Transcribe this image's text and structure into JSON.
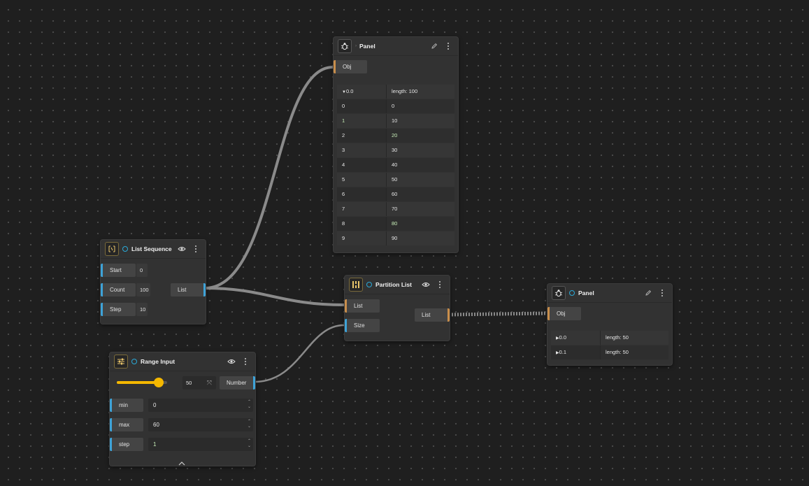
{
  "nodes": {
    "panel_top": {
      "title": "Panel",
      "input_port": "Obj",
      "root_key": "0.0",
      "root_value": "length: 100",
      "rows": [
        {
          "index": "0",
          "value": "0"
        },
        {
          "index": "1",
          "value": "10"
        },
        {
          "index": "2",
          "value": "20"
        },
        {
          "index": "3",
          "value": "30"
        },
        {
          "index": "4",
          "value": "40"
        },
        {
          "index": "5",
          "value": "50"
        },
        {
          "index": "6",
          "value": "60"
        },
        {
          "index": "7",
          "value": "70"
        },
        {
          "index": "8",
          "value": "80"
        },
        {
          "index": "9",
          "value": "90"
        }
      ]
    },
    "list_sequence": {
      "title": "List Sequence",
      "inputs": [
        {
          "label": "Start",
          "value": "0"
        },
        {
          "label": "Count",
          "value": "100"
        },
        {
          "label": "Step",
          "value": "10"
        }
      ],
      "output_port": "List"
    },
    "partition_list": {
      "title": "Partition List",
      "inputs": [
        {
          "label": "List"
        },
        {
          "label": "Size"
        }
      ],
      "output_port": "List"
    },
    "panel_right": {
      "title": "Panel",
      "input_port": "Obj",
      "rows": [
        {
          "key": "0.0",
          "value": "length: 50"
        },
        {
          "key": "0.1",
          "value": "length: 50"
        }
      ]
    },
    "range_input": {
      "title": "Range Input",
      "slider_value": "50",
      "slider_fraction": 0.8333,
      "output_port": "Number",
      "fields": [
        {
          "label": "min",
          "value": "0"
        },
        {
          "label": "max",
          "value": "60"
        },
        {
          "label": "step",
          "value": "1"
        }
      ]
    }
  },
  "colors": {
    "background": "#1f1f1f",
    "wire": "#8a8a8a",
    "port_blue": "#3ea3d8",
    "port_orange": "#c98e4b",
    "slider": "#f5b800",
    "status_ring": "#2aa9d8",
    "highlight_text": "#c6ecb7"
  },
  "icons": {
    "panel": "bug-icon",
    "list_sequence": "sequence-icon",
    "partition_list": "partition-icon",
    "range_input": "sliders-icon",
    "preview": "eye-icon",
    "edit": "pencil-icon",
    "menu": "kebab-menu-icon",
    "clear": "clear-icon",
    "collapse": "chevron-up-icon"
  }
}
